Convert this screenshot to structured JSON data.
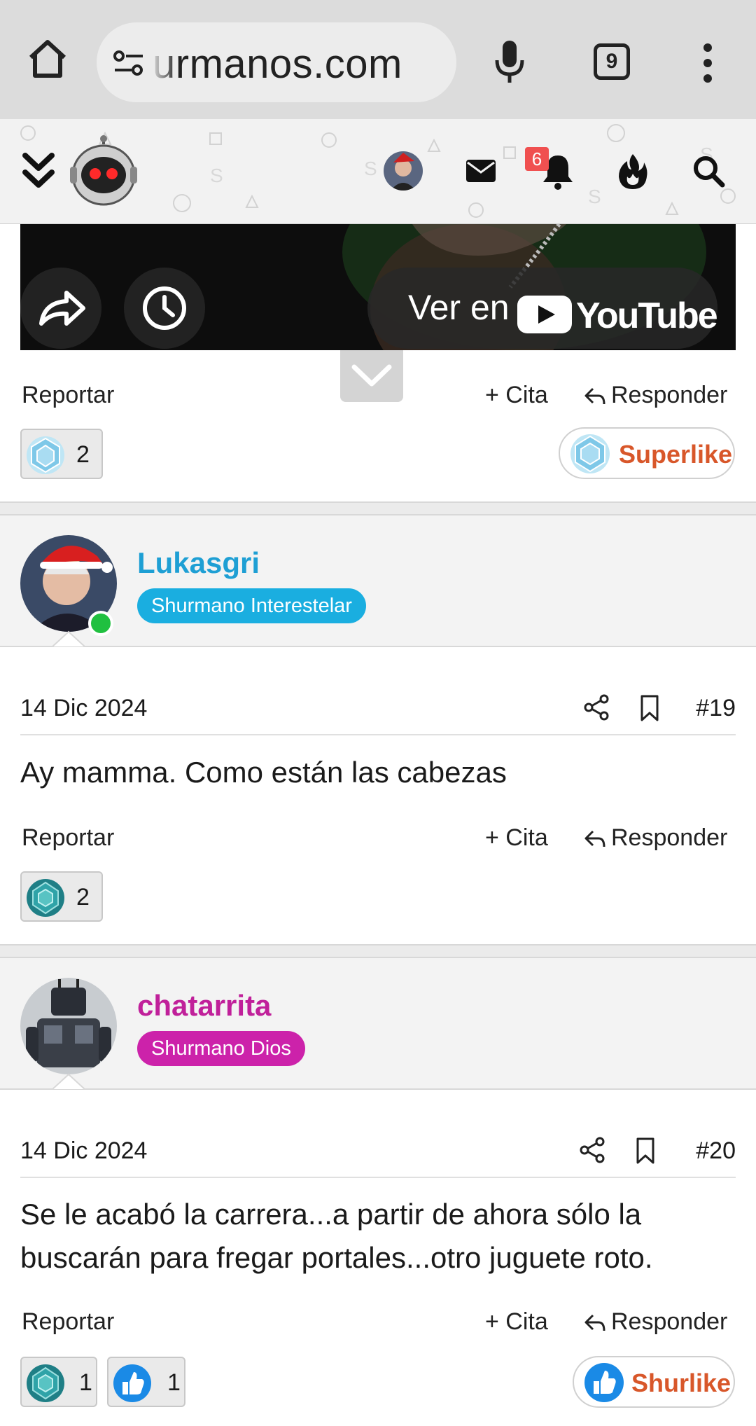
{
  "browser": {
    "url": "urmanos.com",
    "tab_count": "9"
  },
  "header": {
    "notifications_count": "6"
  },
  "video": {
    "watch_label": "Ver en",
    "platform": "YouTube"
  },
  "post18": {
    "report": "Reportar",
    "quote": "+ Cita",
    "reply": "Responder",
    "reaction_count": "2",
    "like_label": "Superlike"
  },
  "post19": {
    "username": "Lukasgri",
    "role": "Shurmano Interestelar",
    "date": "14 Dic 2024",
    "number": "#19",
    "body": "Ay mamma. Como están las cabezas",
    "report": "Reportar",
    "quote": "+ Cita",
    "reply": "Responder",
    "reaction_count": "2"
  },
  "post20": {
    "username": "chatarrita",
    "role": "Shurmano Dios",
    "date": "14 Dic 2024",
    "number": "#20",
    "body": "Se le acabó la carrera...a partir de ahora sólo la buscarán para fregar portales...otro juguete roto.",
    "report": "Reportar",
    "quote": "+ Cita",
    "reply": "Responder",
    "reaction1_count": "1",
    "reaction2_count": "1",
    "like_label": "Shurlike"
  },
  "colors": {
    "role_interestelar": "#1aaee0",
    "role_dios": "#cc22aa",
    "username_blue": "#1e9fd4",
    "username_magenta": "#c0209a",
    "like_orange": "#d8572a"
  }
}
